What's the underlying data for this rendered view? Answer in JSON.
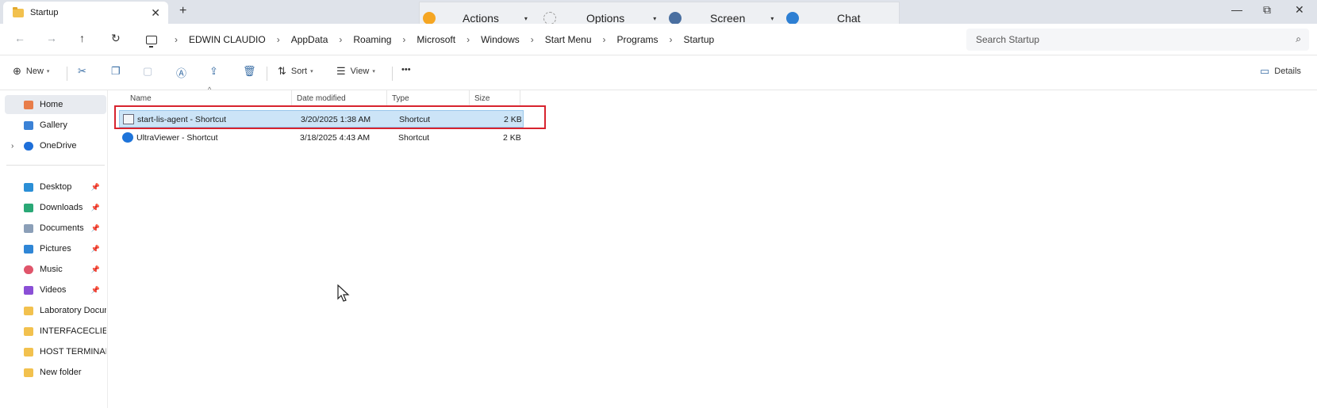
{
  "tab": {
    "title": "Startup",
    "close": "✕",
    "new": "+"
  },
  "window_controls": {
    "minimize": "—",
    "maximize": "⧉",
    "close": "✕"
  },
  "remote_toolbar": {
    "actions": "Actions",
    "options": "Options",
    "screen": "Screen",
    "chat": "Chat"
  },
  "address": {
    "crumbs": [
      "EDWIN CLAUDIO",
      "AppData",
      "Roaming",
      "Microsoft",
      "Windows",
      "Start Menu",
      "Programs",
      "Startup"
    ],
    "search_placeholder": "Search Startup"
  },
  "commands": {
    "new": "New",
    "sort": "Sort",
    "view": "View",
    "more": "•••",
    "details": "Details"
  },
  "sidebar": {
    "home": "Home",
    "gallery": "Gallery",
    "onedrive": "OneDrive",
    "desktop": "Desktop",
    "downloads": "Downloads",
    "documents": "Documents",
    "pictures": "Pictures",
    "music": "Music",
    "videos": "Videos",
    "folder1": "Laboratory Docume",
    "folder2": "INTERFACECLIENT_",
    "folder3": "HOST TERMINAL TC",
    "folder4": "New folder"
  },
  "columns": {
    "name": "Name",
    "date": "Date modified",
    "type": "Type",
    "size": "Size"
  },
  "files": [
    {
      "name": "start-lis-agent - Shortcut",
      "date": "3/20/2025 1:38 AM",
      "type": "Shortcut",
      "size": "2 KB"
    },
    {
      "name": "UltraViewer - Shortcut",
      "date": "3/18/2025 4:43 AM",
      "type": "Shortcut",
      "size": "2 KB"
    }
  ],
  "colors": {
    "accent": "#3a6ea5",
    "selection": "#cce4f7",
    "highlight_border": "#d7232e"
  }
}
